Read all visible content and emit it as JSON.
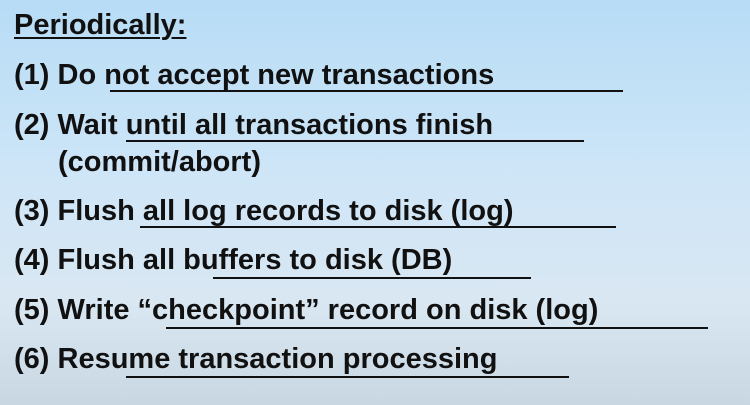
{
  "slide": {
    "heading": "Periodically:",
    "steps": [
      "(1) Do not accept new transactions",
      "(2) Wait until all transactions finish",
      "(commit/abort)",
      "(3) Flush all log records to disk (log)",
      "(4) Flush all buffers to disk (DB)",
      "(5) Write “checkpoint” record on disk (log)",
      "(6) Resume transaction processing"
    ]
  }
}
